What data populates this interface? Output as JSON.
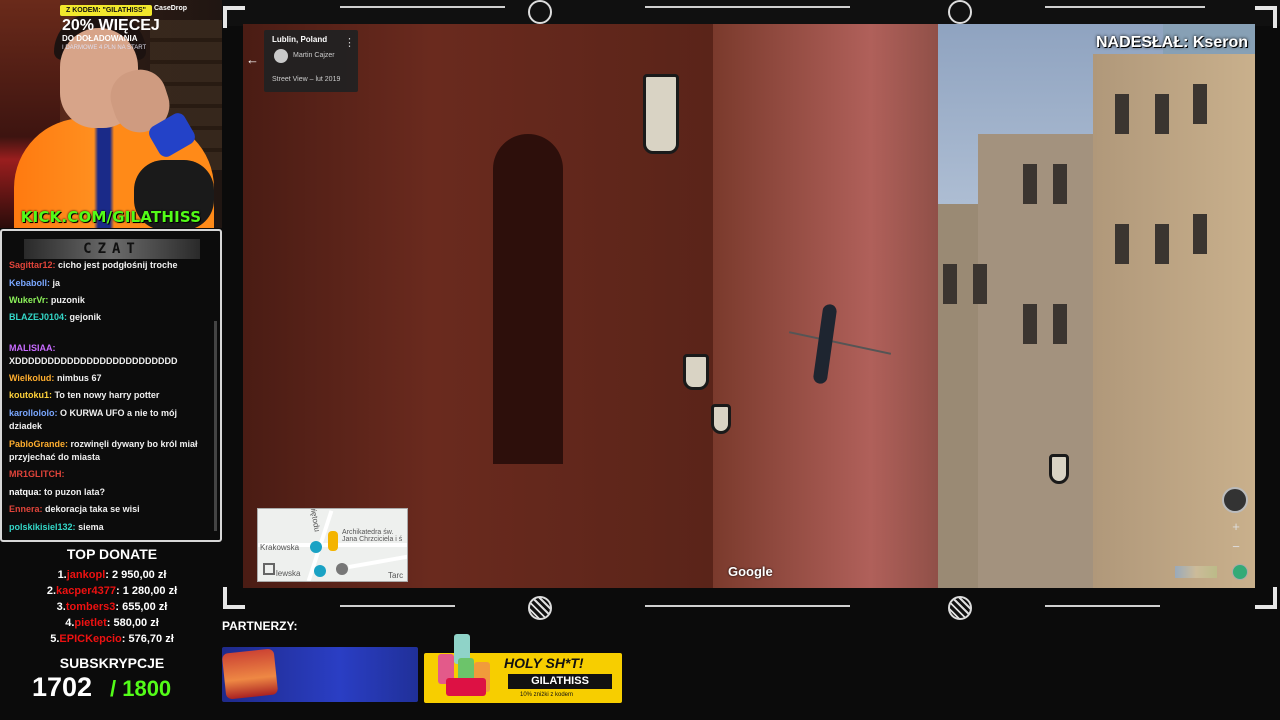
{
  "overlay": {
    "kick_handle": "KICK.COM/GILATHISS",
    "chat_header": "CZAT",
    "submitted_by": "NADESŁAŁ: Kseron",
    "partners_label": "PARTNERZY:"
  },
  "chat": {
    "messages": [
      {
        "user": "Sagittar12:",
        "text": "cicho jest podgłośnij troche",
        "color": "#e0443a"
      },
      {
        "user": "Kebaboll:",
        "text": "ja",
        "color": "#7aa7ff"
      },
      {
        "user": "WukerVr:",
        "text": "puzonik",
        "color": "#8cf25a"
      },
      {
        "user": "BLAZEJ0104:",
        "text": "gejonik",
        "color": "#34d7c8"
      },
      {
        "user": "MALISIAA:",
        "text": "XDDDDDDDDDDDDDDDDDDDDDDDDD",
        "color": "#c86bff"
      },
      {
        "user": "Wielkolud:",
        "text": "nimbus 67",
        "color": "#ffae2e"
      },
      {
        "user": "koutoku1:",
        "text": "To ten nowy harry potter",
        "color": "#ffd23a"
      },
      {
        "user": "karollololo:",
        "text": "O KURWA UFO a nie to mój dziadek",
        "color": "#7aa7ff"
      },
      {
        "user": "PabloGrande:",
        "text": "rozwinęli dywany bo król miał przyjechać do miasta",
        "color": "#ffae2e"
      },
      {
        "user": "MR1GLITCH:",
        "text": "",
        "color": "#e0443a"
      },
      {
        "user": "natqua:",
        "text": "to puzon lata?",
        "color": "#ffffff"
      },
      {
        "user": "Ennera:",
        "text": "dekoracja taka se wisi",
        "color": "#e0443a"
      },
      {
        "user": "polskikisiel132:",
        "text": "siema",
        "color": "#34d7c8"
      }
    ]
  },
  "donate": {
    "title": "TOP DONATE",
    "rows": [
      {
        "rank": "1.",
        "name": "jankopl",
        "amount": ": 2 950,00 zł"
      },
      {
        "rank": "2.",
        "name": "kacper4377",
        "amount": ": 1 280,00 zł"
      },
      {
        "rank": "3.",
        "name": "tombers3",
        "amount": ": 655,00 zł"
      },
      {
        "rank": "4.",
        "name": "pietlet",
        "amount": ": 580,00 zł"
      },
      {
        "rank": "5.",
        "name": "EPICKepcio",
        "amount": ": 576,70 zł"
      }
    ]
  },
  "subs": {
    "title": "SUBSKRYPCJE",
    "current": "1702",
    "goal": "/ 1800"
  },
  "streetview": {
    "place": "Lublin, Poland",
    "author": "Martin Cajzer",
    "date": "Street View – lut 2019",
    "brand": "Google",
    "map_labels": {
      "street1": "Świętodu",
      "church": "Archikatedra św. Jana Chrzciciela i ś",
      "street2": "Krakowska",
      "street3": "lewska",
      "street4": "Tarc"
    }
  },
  "ads": {
    "casedrop": {
      "code": "Z KODEM: \"GILATHISS\"",
      "brand": "CaseDrop",
      "headline": "20% WIĘCEJ",
      "sub": "DO DOŁADOWANIA",
      "fine": "I DARMOWE 4 PLN NA START"
    },
    "holy": {
      "title": "HOLY SH*T!",
      "code": "GILATHISS",
      "sub": "10% zniżki z kodem"
    }
  },
  "colors": {
    "kick_green": "#53fc18",
    "donor_red": "#e11111"
  },
  "icons": {
    "back": "arrow-left-icon",
    "more": "more-vertical-icon",
    "compass": "compass-icon",
    "zoom_in": "plus-icon",
    "zoom_out": "minus-icon",
    "expand": "expand-icon",
    "pin": "map-pin-icon"
  }
}
